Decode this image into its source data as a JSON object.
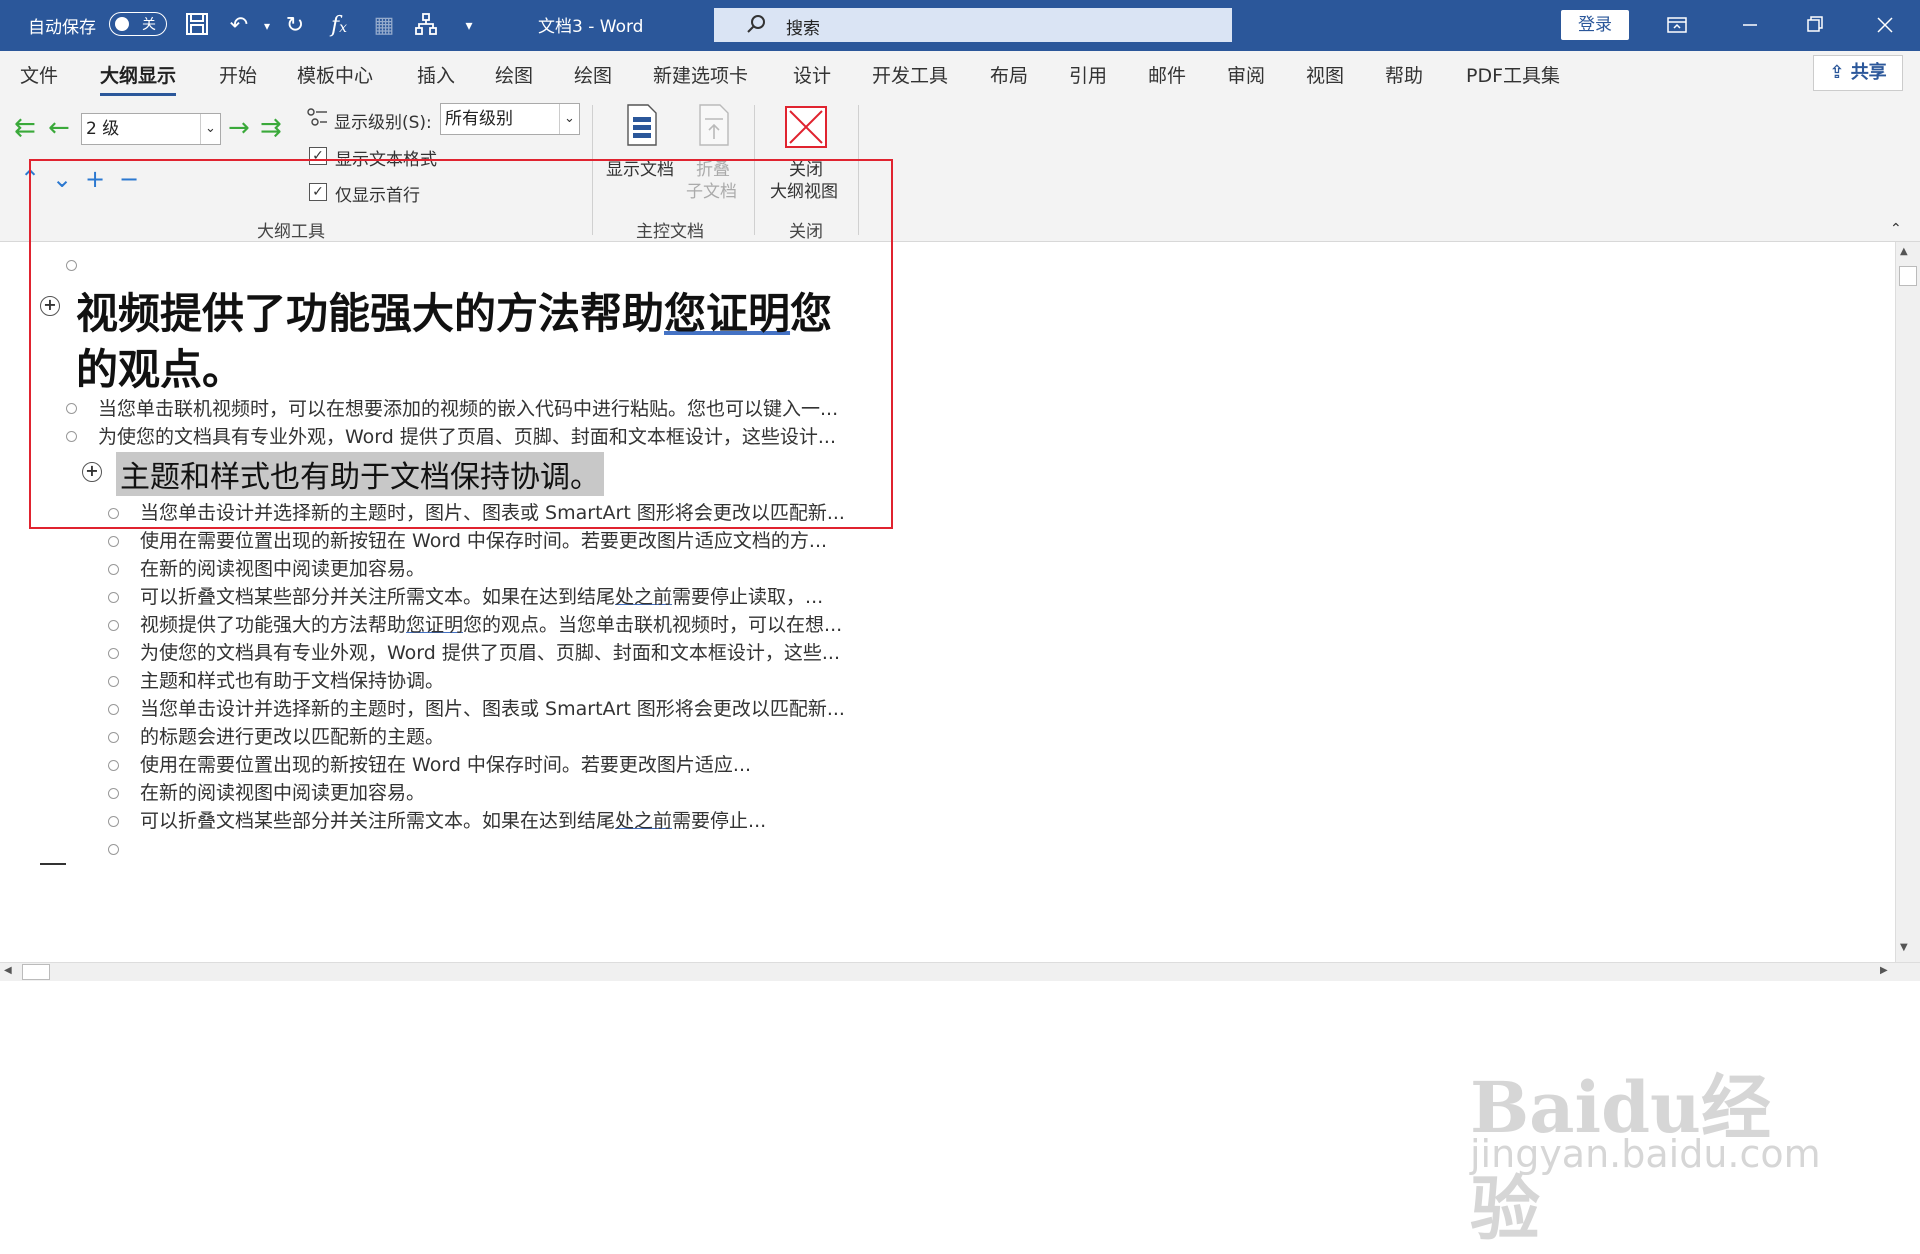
{
  "titlebar": {
    "autosave_label": "自动保存",
    "autosave_state": "关",
    "doc_title": "文档3  -  Word",
    "search_placeholder": "搜索",
    "login": "登录"
  },
  "tabs": [
    {
      "label": "文件",
      "active": false
    },
    {
      "label": "大纲显示",
      "active": true
    },
    {
      "label": "开始",
      "active": false
    },
    {
      "label": "模板中心",
      "active": false
    },
    {
      "label": "插入",
      "active": false
    },
    {
      "label": "绘图",
      "active": false
    },
    {
      "label": "绘图",
      "active": false
    },
    {
      "label": "新建选项卡",
      "active": false
    },
    {
      "label": "设计",
      "active": false
    },
    {
      "label": "开发工具",
      "active": false
    },
    {
      "label": "布局",
      "active": false
    },
    {
      "label": "引用",
      "active": false
    },
    {
      "label": "邮件",
      "active": false
    },
    {
      "label": "审阅",
      "active": false
    },
    {
      "label": "视图",
      "active": false
    },
    {
      "label": "帮助",
      "active": false
    },
    {
      "label": "PDF工具集",
      "active": false
    }
  ],
  "share": "共享",
  "ribbon": {
    "level_value": "2 级",
    "show_level_label": "显示级别(S):",
    "show_level_value": "所有级别",
    "show_text_format": "显示文本格式",
    "show_first_line": "仅显示首行",
    "show_document": "显示文档",
    "collapse_subdoc_1": "折叠",
    "collapse_subdoc_2": "子文档",
    "close_1": "关闭",
    "close_2": "大纲视图",
    "group_outline_tools": "大纲工具",
    "group_master_doc": "主控文档",
    "group_close": "关闭"
  },
  "document": {
    "heading1_line1_pre": "视频提供了功能强大的方法帮助",
    "heading1_line1_ul": "您证明",
    "heading1_line1_post": "您",
    "heading1_line2": "的观点。",
    "body_l1": [
      "当您单击联机视频时，可以在想要添加的视频的嵌入代码中进行粘贴。您也可以键入一...",
      "为使您的文档具有专业外观，Word 提供了页眉、页脚、封面和文本框设计，这些设计..."
    ],
    "heading2": "主题和样式也有助于文档保持协调。",
    "body_l2": {
      "l0": "当您单击设计并选择新的主题时，图片、图表或 SmartArt 图形将会更改以匹配新...",
      "l1": "使用在需要位置出现的新按钮在 Word 中保存时间。若要更改图片适应文档的方...",
      "l2": "在新的阅读视图中阅读更加容易。",
      "l3_pre": "可以折叠文档某些部分并关注所需文本。如果在达到结尾",
      "l3_ul": "处之前",
      "l3_post": "需要停止读取，...",
      "l4_pre": "视频提供了功能强大的方法帮助",
      "l4_ul": "您证明",
      "l4_post": "您的观点。当您单击联机视频时，可以在想...",
      "l5": "为使您的文档具有专业外观，Word 提供了页眉、页脚、封面和文本框设计，这些...",
      "l6": "主题和样式也有助于文档保持协调。",
      "l7": "当您单击设计并选择新的主题时，图片、图表或 SmartArt 图形将会更改以匹配新...",
      "l8": "的标题会进行更改以匹配新的主题。",
      "l9": "使用在需要位置出现的新按钮在 Word 中保存时间。若要更改图片适应...",
      "l10": "在新的阅读视图中阅读更加容易。",
      "l11_pre": "可以折叠文档某些部分并关注所需文本。如果在达到结尾",
      "l11_ul": "处之前",
      "l11_post": "需要停止..."
    }
  },
  "watermark": {
    "brand": "Baidu经验",
    "url": "jingyan.baidu.com"
  },
  "colors": {
    "titlebar": "#2b579a",
    "highlight_box": "#e0232f",
    "outline_arrows": "#3aa93a"
  }
}
